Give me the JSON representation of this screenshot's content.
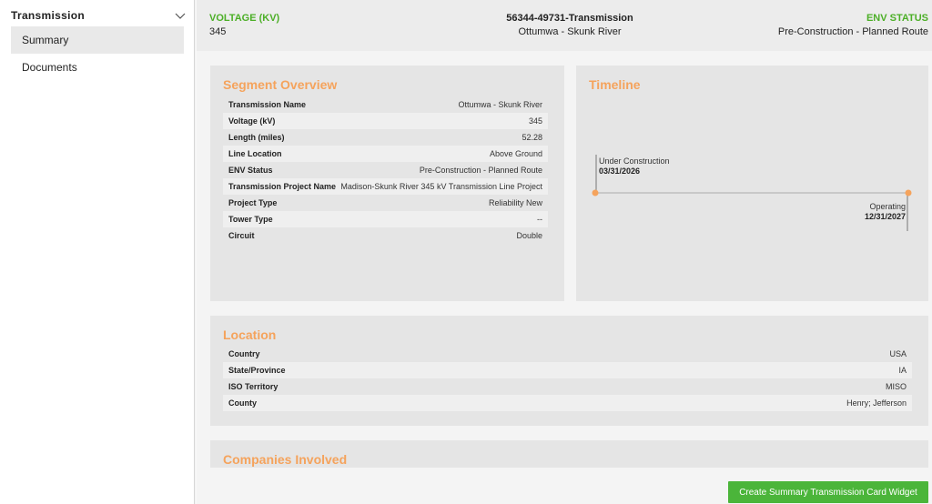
{
  "sidebar": {
    "title": "Transmission",
    "items": [
      {
        "label": "Summary",
        "active": true
      },
      {
        "label": "Documents",
        "active": false
      }
    ]
  },
  "header": {
    "voltage_label": "VOLTAGE (KV)",
    "voltage_value": "345",
    "project_id": "56344-49731-Transmission",
    "project_name": "Ottumwa - Skunk River",
    "env_status_label": "ENV STATUS",
    "env_status_value": "Pre-Construction - Planned Route"
  },
  "segment_overview": {
    "title": "Segment Overview",
    "rows": [
      {
        "key": "Transmission Name",
        "value": "Ottumwa - Skunk River"
      },
      {
        "key": "Voltage (kV)",
        "value": "345"
      },
      {
        "key": "Length (miles)",
        "value": "52.28"
      },
      {
        "key": "Line Location",
        "value": "Above Ground"
      },
      {
        "key": "ENV Status",
        "value": "Pre-Construction - Planned Route"
      },
      {
        "key": "Transmission Project Name",
        "value": "Madison-Skunk River 345 kV Transmission Line Project"
      },
      {
        "key": "Project Type",
        "value": "Reliability New"
      },
      {
        "key": "Tower Type",
        "value": "--"
      },
      {
        "key": "Circuit",
        "value": "Double"
      }
    ]
  },
  "timeline": {
    "title": "Timeline",
    "events": [
      {
        "label": "Under Construction",
        "date": "03/31/2026"
      },
      {
        "label": "Operating",
        "date": "12/31/2027"
      }
    ],
    "accent": "#f5a35c"
  },
  "location": {
    "title": "Location",
    "rows": [
      {
        "key": "Country",
        "value": "USA"
      },
      {
        "key": "State/Province",
        "value": "IA"
      },
      {
        "key": "ISO Territory",
        "value": "MISO"
      },
      {
        "key": "County",
        "value": "Henry; Jefferson"
      }
    ]
  },
  "companies": {
    "title": "Companies Involved"
  },
  "actions": {
    "create_widget_label": "Create Summary Transmission Card Widget"
  },
  "colors": {
    "accent_orange": "#f5a35c",
    "accent_green": "#4bb53a"
  }
}
